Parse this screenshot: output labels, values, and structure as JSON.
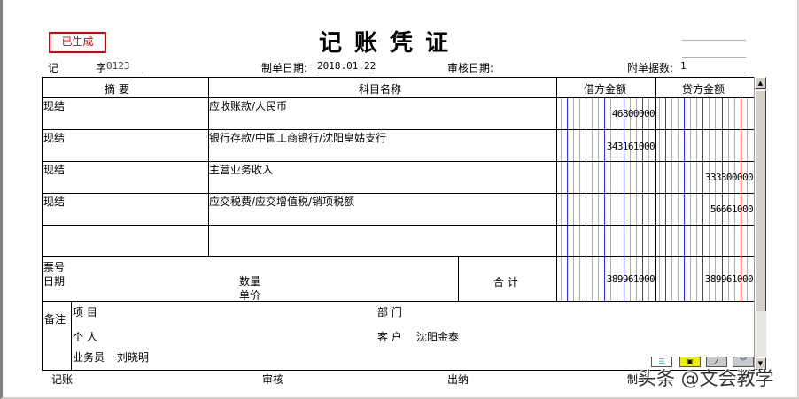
{
  "status_stamp": "已生成",
  "title": "记账凭证",
  "voucher": {
    "type_label": "记",
    "type_value": "",
    "number_label": "字",
    "number_value": "0123",
    "date_label": "制单日期:",
    "date_value": "2018.01.22",
    "audit_date_label": "审核日期:",
    "audit_date_value": "",
    "attach_label": "附单据数:",
    "attach_value": "1"
  },
  "table": {
    "headers": {
      "summary": "摘 要",
      "account": "科目名称",
      "debit": "借方金额",
      "credit": "贷方金额"
    },
    "rows": [
      {
        "summary": "现结",
        "account": "应收账款/人民币",
        "debit": "46800000",
        "credit": ""
      },
      {
        "summary": "现结",
        "account": "银行存款/中国工商银行/沈阳皇姑支行",
        "debit": "343161000",
        "credit": ""
      },
      {
        "summary": "现结",
        "account": "主营业务收入",
        "debit": "",
        "credit": "333300000"
      },
      {
        "summary": "现结",
        "account": "应交税费/应交增值税/销项税额",
        "debit": "",
        "credit": "56661000"
      },
      {
        "summary": "",
        "account": "",
        "debit": "",
        "credit": ""
      }
    ],
    "footer": {
      "ticket_label": "票号",
      "date_label": "日期",
      "qty_label": "数量",
      "price_label": "单价",
      "total_label": "合 计",
      "debit_total": "389961000",
      "credit_total": "389961000"
    }
  },
  "remarks": {
    "label": "备注",
    "project_label": "项 目",
    "project_value": "",
    "dept_label": "部 门",
    "dept_value": "",
    "person_label": "个 人",
    "person_value": "",
    "customer_label": "客 户",
    "customer_value": "沈阳金泰",
    "salesman_label": "业务员",
    "salesman_value": "刘晓明"
  },
  "signatures": {
    "bookkeeping": "记账",
    "audit": "审核",
    "cashier": "出纳",
    "maker": "制单"
  },
  "watermark": "头条 @文会教学",
  "colors": {
    "stamp": "#e00000",
    "blue_line": "#3030ff",
    "red_line": "#ff0000"
  }
}
